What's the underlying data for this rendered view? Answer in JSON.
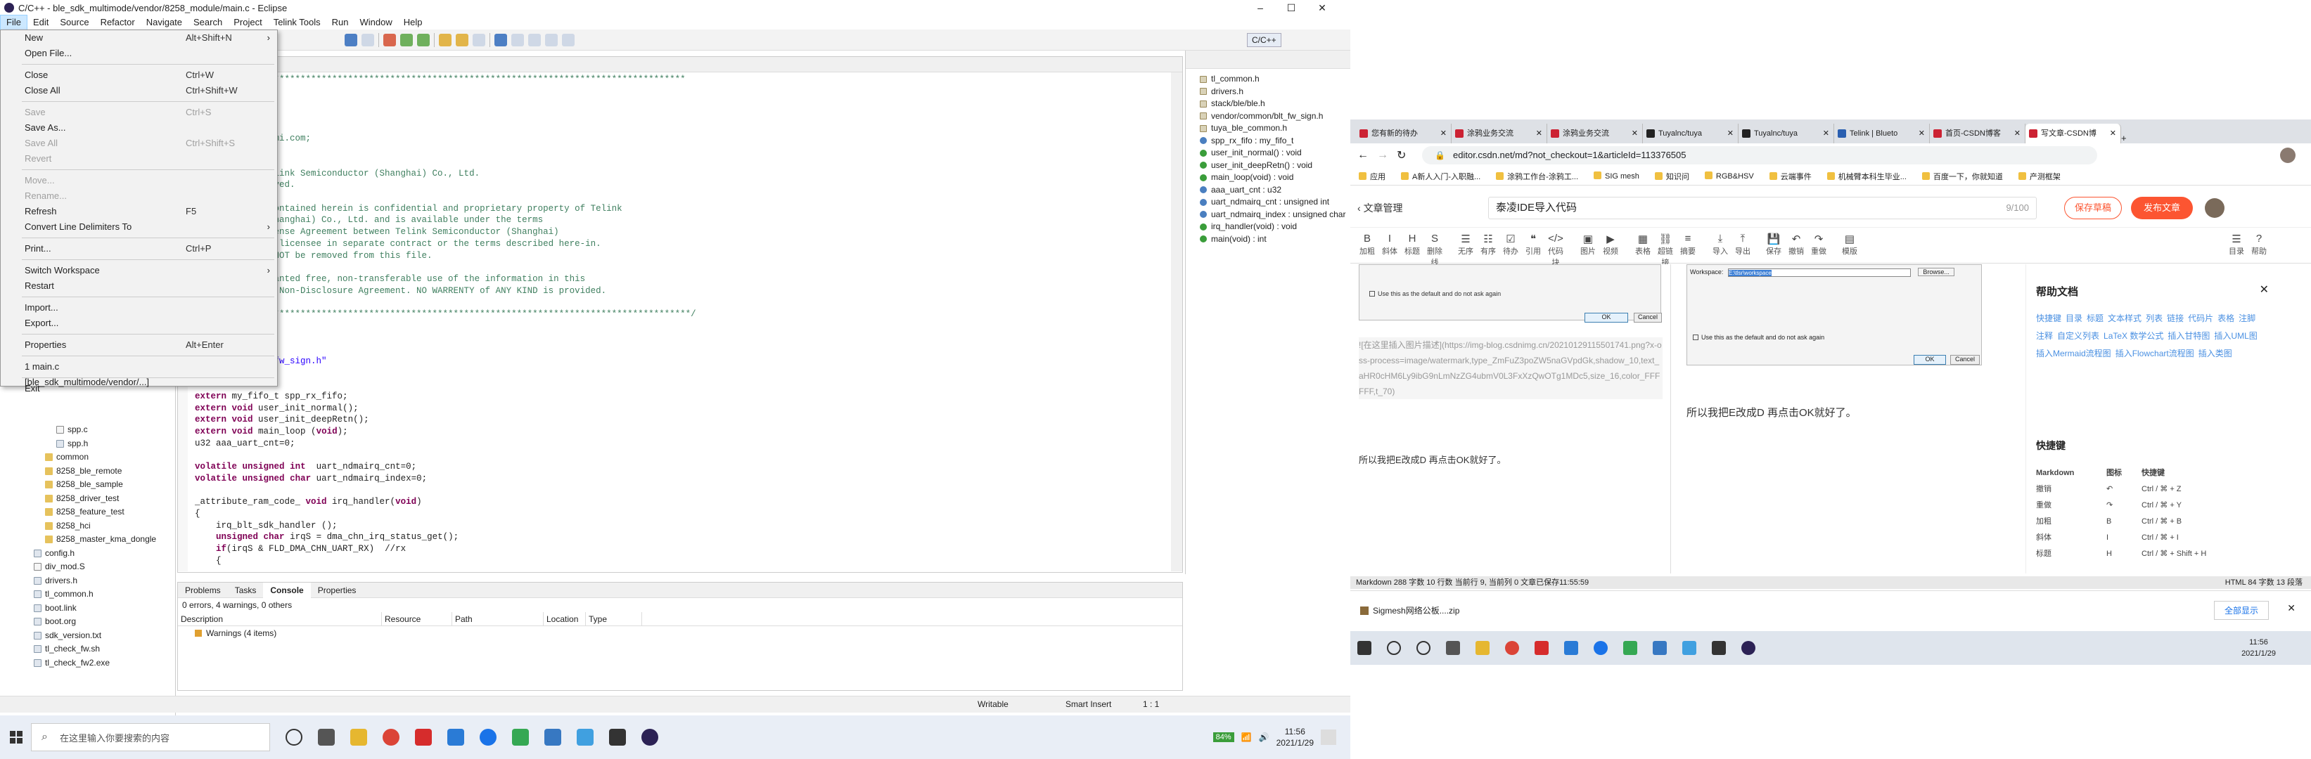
{
  "eclipse": {
    "title": "C/C++ - ble_sdk_multimode/vendor/8258_module/main.c - Eclipse",
    "menus": [
      "File",
      "Edit",
      "Source",
      "Refactor",
      "Navigate",
      "Search",
      "Project",
      "Telink Tools",
      "Run",
      "Window",
      "Help"
    ],
    "perspective": "C/C++",
    "file_menu": [
      {
        "label": "New",
        "shortcut": "Alt+Shift+N",
        "arrow": true
      },
      {
        "label": "Open File...",
        "shortcut": ""
      },
      {
        "sep": true
      },
      {
        "label": "Close",
        "shortcut": "Ctrl+W"
      },
      {
        "label": "Close All",
        "shortcut": "Ctrl+Shift+W"
      },
      {
        "sep": true
      },
      {
        "label": "Save",
        "shortcut": "Ctrl+S",
        "disabled": true
      },
      {
        "label": "Save As...",
        "shortcut": ""
      },
      {
        "label": "Save All",
        "shortcut": "Ctrl+Shift+S",
        "disabled": true
      },
      {
        "label": "Revert",
        "shortcut": "",
        "disabled": true
      },
      {
        "sep": true
      },
      {
        "label": "Move...",
        "shortcut": "",
        "disabled": true
      },
      {
        "label": "Rename...",
        "shortcut": "",
        "disabled": true
      },
      {
        "label": "Refresh",
        "shortcut": "F5"
      },
      {
        "label": "Convert Line Delimiters To",
        "shortcut": "",
        "arrow": true
      },
      {
        "sep": true
      },
      {
        "label": "Print...",
        "shortcut": "Ctrl+P"
      },
      {
        "sep": true
      },
      {
        "label": "Switch Workspace",
        "shortcut": "",
        "arrow": true
      },
      {
        "label": "Restart",
        "shortcut": ""
      },
      {
        "sep": true
      },
      {
        "label": "Import...",
        "shortcut": ""
      },
      {
        "label": "Export...",
        "shortcut": ""
      },
      {
        "sep": true
      },
      {
        "label": "Properties",
        "shortcut": "Alt+Enter"
      },
      {
        "sep": true
      },
      {
        "label": "1 main.c  [ble_sdk_multimode/vendor/...]",
        "shortcut": ""
      },
      {
        "sep": true
      },
      {
        "label": "Exit",
        "shortcut": ""
      }
    ],
    "tree": [
      "spp.c",
      "spp.h",
      "common",
      "8258_ble_remote",
      "8258_ble_sample",
      "8258_driver_test",
      "8258_feature_test",
      "8258_hci",
      "8258_master_kma_dongle",
      "config.h",
      "div_mod.S",
      "drivers.h",
      "tl_common.h",
      "boot.link",
      "boot.org",
      "sdk_version.txt",
      "tl_check_fw.sh",
      "tl_check_fw2.exe"
    ],
    "code_lines": [
      {
        "t": "*********************************************************************************************",
        "c": "cmt"
      },
      {
        "t": "ain.c",
        "c": "cmt"
      },
      {
        "t": "",
        "c": ""
      },
      {
        "t": "r TLSR chips",
        "c": "cmt"
      },
      {
        "t": "",
        "c": ""
      },
      {
        "t": "ublic@telink-semi.com;",
        "c": "cmt"
      },
      {
        "t": "p. 18, 2015",
        "c": "cmt"
      },
      {
        "t": "",
        "c": ""
      },
      {
        "t": "opyright (c) Telink Semiconductor (Shanghai) Co., Ltd.",
        "c": "cmt"
      },
      {
        "t": "ll rights reserved.",
        "c": "cmt"
      },
      {
        "t": "",
        "c": ""
      },
      {
        "t": "e information contained herein is confidential and proprietary property of Telink",
        "c": "cmt"
      },
      {
        "t": "emiconductor (Shanghai) Co., Ltd. and is available under the terms",
        "c": "cmt"
      },
      {
        "t": " Commercial License Agreement between Telink Semiconductor (Shanghai)",
        "c": "cmt"
      },
      {
        "t": "., Ltd. and the licensee in separate contract or the terms described here-in.",
        "c": "cmt"
      },
      {
        "t": "s heading MUST NOT be removed from this file.",
        "c": "cmt"
      },
      {
        "t": "",
        "c": ""
      },
      {
        "t": "icensees are granted free, non-transferable use of the information in this",
        "c": "cmt"
      },
      {
        "t": "le under Mutual Non-Disclosure Agreement. NO WARRENTY of ANY KIND is provided.",
        "c": "cmt"
      },
      {
        "t": "",
        "c": ""
      },
      {
        "t": "**********************************************************************************************/",
        "c": "cmt"
      },
      {
        "t": "common.h\"",
        "c": "str"
      },
      {
        "t": "rs.h\"",
        "c": "str"
      },
      {
        "t": "k/ble/ble.h\"",
        "c": "str"
      },
      {
        "t": "dor/common/blt_fw_sign.h\"",
        "c": "str"
      },
      {
        "t": "ble_common.h\"",
        "c": "str"
      },
      {
        "t": "",
        "c": ""
      },
      {
        "t": "extern my_fifo_t spp_rx_fifo;",
        "c": ""
      },
      {
        "t": "extern void user_init_normal();",
        "c": ""
      },
      {
        "t": "extern void user_init_deepRetn();",
        "c": ""
      },
      {
        "t": "extern void main_loop (void);",
        "c": ""
      },
      {
        "t": "u32 aaa_uart_cnt=0;",
        "c": ""
      },
      {
        "t": "",
        "c": ""
      },
      {
        "t": "volatile unsigned int  uart_ndmairq_cnt=0;",
        "c": ""
      },
      {
        "t": "volatile unsigned char uart_ndmairq_index=0;",
        "c": ""
      },
      {
        "t": "",
        "c": ""
      },
      {
        "t": "_attribute_ram_code_ void irq_handler(void)",
        "c": ""
      },
      {
        "t": "{",
        "c": ""
      },
      {
        "t": "    irq_blt_sdk_handler ();",
        "c": ""
      },
      {
        "t": "    unsigned char irqS = dma_chn_irq_status_get();",
        "c": ""
      },
      {
        "t": "    if(irqS & FLD_DMA_CHN_UART_RX)  //rx",
        "c": ""
      },
      {
        "t": "    {",
        "c": ""
      }
    ],
    "outline": [
      {
        "t": "tl_common.h",
        "k": "h"
      },
      {
        "t": "drivers.h",
        "k": "h"
      },
      {
        "t": "stack/ble/ble.h",
        "k": "h"
      },
      {
        "t": "vendor/common/blt_fw_sign.h",
        "k": "h"
      },
      {
        "t": "tuya_ble_common.h",
        "k": "h"
      },
      {
        "t": "spp_rx_fifo : my_fifo_t",
        "k": "b"
      },
      {
        "t": "user_init_normal() : void",
        "k": "g"
      },
      {
        "t": "user_init_deepRetn() : void",
        "k": "g"
      },
      {
        "t": "main_loop(void) : void",
        "k": "g"
      },
      {
        "t": "aaa_uart_cnt : u32",
        "k": "b"
      },
      {
        "t": "uart_ndmairq_cnt : unsigned int",
        "k": "b"
      },
      {
        "t": "uart_ndmairq_index : unsigned char",
        "k": "b"
      },
      {
        "t": "irq_handler(void) : void",
        "k": "g"
      },
      {
        "t": "main(void) : int",
        "k": "g"
      }
    ],
    "console_tabs": [
      "Problems",
      "Tasks",
      "Console",
      "Properties"
    ],
    "problems_summary": "0 errors, 4 warnings, 0 others",
    "problems_cols": [
      "Description",
      "Resource",
      "Path",
      "Location",
      "Type"
    ],
    "problems_row": "Warnings (4 items)",
    "status": {
      "writable": "Writable",
      "insert": "Smart Insert",
      "pos": "1 : 1"
    },
    "taskbar_search": "在这里输入你要搜索的内容",
    "clock_time": "11:56",
    "clock_date": "2021/1/29",
    "battery": "84%"
  },
  "browser": {
    "tabs": [
      "您有新的待办",
      "涂鸦业务交流",
      "涂鸦业务交流",
      "Tuyalnc/tuya",
      "Tuyalnc/tuya",
      "Telink | Blueto",
      "首页-CSDN博客",
      "写文章-CSDN博"
    ],
    "url": "editor.csdn.net/md?not_checkout=1&articleId=113376505",
    "bookmarks": [
      "应用",
      "A新人入门-入职融...",
      "涂鸦工作台-涂鸦工...",
      "SIG mesh",
      "知识问",
      "RGB&HSV",
      "云端事件",
      "机械臂本科生毕业...",
      "百度一下，你就知道",
      "产测框架"
    ],
    "back_label": "文章管理",
    "article_title": "泰凌IDE导入代码",
    "title_count": "9/100",
    "save_label": "保存草稿",
    "publish_label": "发布文章",
    "tools": [
      "加粗",
      "斜体",
      "标题",
      "删除线",
      "无序",
      "有序",
      "待办",
      "引用",
      "代码块",
      "图片",
      "视频",
      "表格",
      "超链接",
      "摘要",
      "导入",
      "导出",
      "保存",
      "撤销",
      "重做",
      "模版",
      "目录",
      "帮助"
    ],
    "tool_icons": [
      "B",
      "I",
      "H",
      "S",
      "☰",
      "☷",
      "☑",
      "❝",
      "</>",
      "▣",
      "▶",
      "▦",
      "⛓",
      "≡",
      "⤓",
      "⤒",
      "💾",
      "↶",
      "↷",
      "▤",
      "☰",
      "?"
    ],
    "md_text_link": "![在这里插入图片描述](https://img-blog.csdnimg.cn/20210129115501741.png?x-oss-process=image/watermark,type_ZmFuZ3poZW5naGVpdGk,shadow_10,text_aHR0cHM6Ly9ibG9nLmNzZG4ubmV0L3FxXzQwOTg1MDc5,size_16,color_FFFFFF,t_70)",
    "md_text": "所以我把E改成D  再点击OK就好了。",
    "preview_text": "所以我把E改成D  再点击OK就好了。",
    "dialog": {
      "workspace": "Workspace:",
      "ws_value": "E:\\tlsr\\workspace",
      "browse": "Browse...",
      "checkbox": "Use this as the default and do not ask again",
      "ok": "OK",
      "cancel": "Cancel"
    },
    "help": {
      "title": "帮助文档",
      "chips": [
        "快捷键",
        "目录",
        "标题",
        "文本样式",
        "列表",
        "链接",
        "代码片",
        "表格",
        "注脚",
        "注释",
        "自定义列表",
        "LaTeX 数学公式",
        "插入甘特图",
        "插入UML图",
        "插入Mermaid流程图",
        "插入Flowchart流程图",
        "插入类图"
      ],
      "sub": "快捷键",
      "cols": [
        "Markdown",
        "图标",
        "快捷键"
      ],
      "rows": [
        [
          "撤销",
          "↶",
          "Ctrl / ⌘ + Z"
        ],
        [
          "重做",
          "↷",
          "Ctrl / ⌘ + Y"
        ],
        [
          "加粗",
          "B",
          "Ctrl / ⌘ + B"
        ],
        [
          "斜体",
          "I",
          "Ctrl / ⌘ + I"
        ],
        [
          "标题",
          "H",
          "Ctrl / ⌘ + Shift + H"
        ]
      ]
    },
    "md_status": "Markdown  288 字数  10 行数  当前行 9, 当前列 0  文章已保存11:55:59",
    "md_status_right": "HTML  84 字数  13 段落",
    "download_file": "Sigmesh网络公板....zip",
    "show_all": "全部显示",
    "clock_time": "11:56",
    "clock_date": "2021/1/29"
  }
}
